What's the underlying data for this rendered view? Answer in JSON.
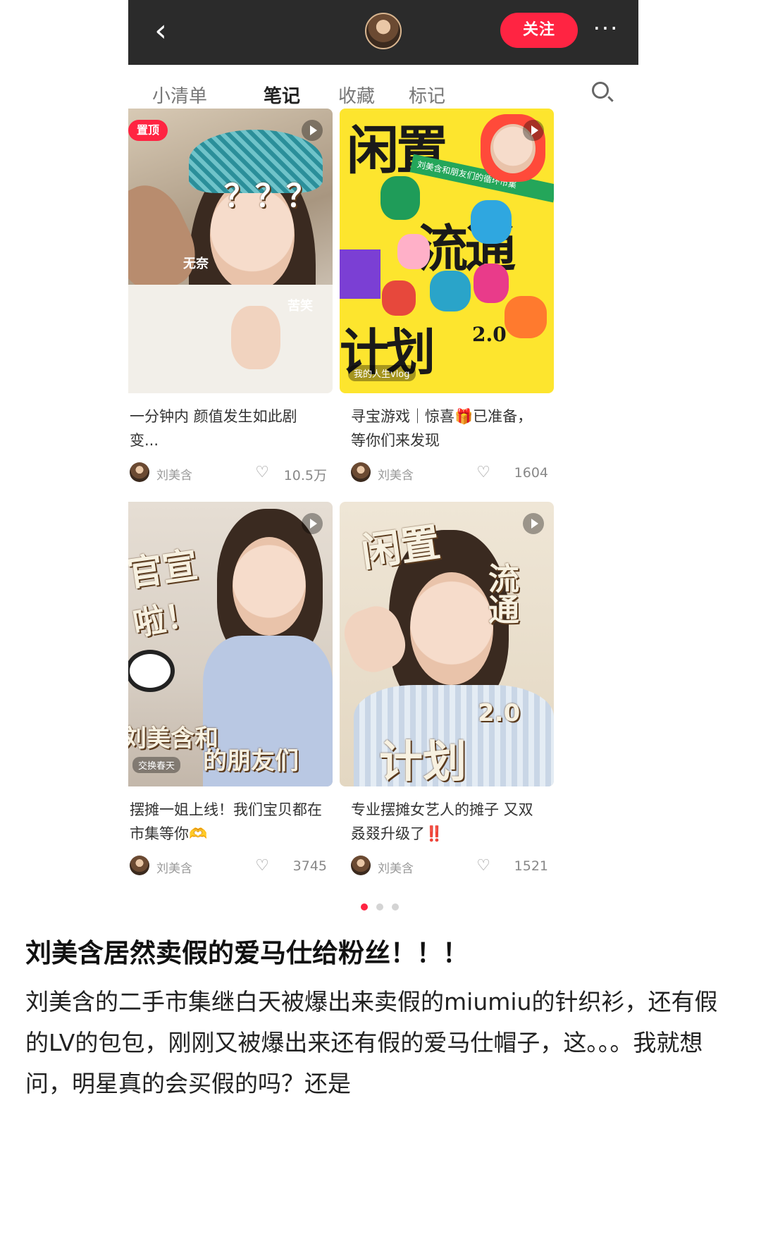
{
  "header": {
    "back_icon": "chevron-left-icon",
    "follow_label": "关注",
    "more_icon": "more-dots-icon",
    "more_text": "···",
    "back_text": "‹"
  },
  "tabs": [
    {
      "label": "小清单",
      "active": false
    },
    {
      "label": "笔记",
      "active": true
    },
    {
      "label": "收藏",
      "active": false
    },
    {
      "label": "标记",
      "active": false
    }
  ],
  "accent_color": "#ff2442",
  "notes": [
    {
      "pinned_badge": "置顶",
      "overlay_texts": [
        "？？？",
        "无奈",
        "苦笑"
      ],
      "title": "一分钟内 颜值发生如此剧变...",
      "author": "刘美含",
      "likes": "10.5万"
    },
    {
      "overlay_texts": [
        "闲置",
        "流通",
        "计划",
        "2.0",
        "刘美含和朋友们的循环市集",
        "我的人生vlog"
      ],
      "title": "寻宝游戏｜惊喜🎁已准备，等你们来发现",
      "author": "刘美含",
      "likes": "1604"
    },
    {
      "overlay_texts": [
        "官宣",
        "啦！",
        "刘美含和",
        "的朋友们",
        "交换春天"
      ],
      "title": "摆摊一姐上线！我们宝贝都在市集等你🫶",
      "author": "刘美含",
      "likes": "3745"
    },
    {
      "overlay_texts": [
        "闲置",
        "流通",
        "2.0",
        "计划"
      ],
      "title": "专业摆摊女艺人的摊子 又双叒叕升级了‼️",
      "author": "刘美含",
      "likes": "1521"
    }
  ],
  "pagination": {
    "total": 3,
    "active_index": 0
  },
  "post": {
    "title": "刘美含居然卖假的爱马仕给粉丝！！！",
    "body": "刘美含的二手市集继白天被爆出来卖假的miumiu的针织衫，还有假的LV的包包，刚刚又被爆出来还有假的爱马仕帽子，这。。。我就想问，明星真的会买假的吗？还是"
  }
}
